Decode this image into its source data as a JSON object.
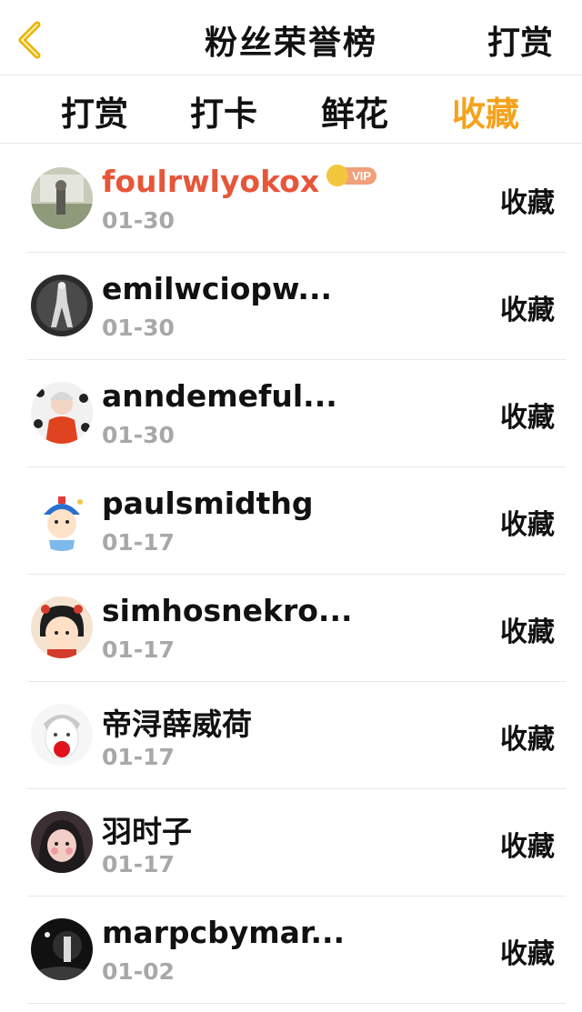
{
  "header": {
    "title": "粉丝荣誉榜",
    "right_action": "打赏",
    "back_icon": "chevron-left-icon",
    "back_icon_color": "#e9b100"
  },
  "tabs": [
    {
      "label": "打赏",
      "active": false
    },
    {
      "label": "打卡",
      "active": false
    },
    {
      "label": "鲜花",
      "active": false
    },
    {
      "label": "收藏",
      "active": true
    }
  ],
  "colors": {
    "accent": "#f5a21b",
    "vip_name": "#e8563a",
    "date": "#a8a8a8"
  },
  "rows": [
    {
      "name": "foulrwlyokox",
      "date": "01-30",
      "action": "收藏",
      "vip": true,
      "vip_label": "VIP",
      "avatar": "avatar-outdoor-person"
    },
    {
      "name": "emilwciopw...",
      "date": "01-30",
      "action": "收藏",
      "vip": false,
      "avatar": "avatar-bw-figure"
    },
    {
      "name": "anndemeful...",
      "date": "01-30",
      "action": "收藏",
      "vip": false,
      "avatar": "avatar-red-shirt"
    },
    {
      "name": "paulsmidthg",
      "date": "01-17",
      "action": "收藏",
      "vip": false,
      "avatar": "avatar-cartoon-boy"
    },
    {
      "name": "simhosnekro...",
      "date": "01-17",
      "action": "收藏",
      "vip": false,
      "avatar": "avatar-cartoon-girl"
    },
    {
      "name": "帝浔薛威荷",
      "date": "01-17",
      "action": "收藏",
      "vip": false,
      "avatar": "avatar-white-face"
    },
    {
      "name": "羽时子",
      "date": "01-17",
      "action": "收藏",
      "vip": false,
      "avatar": "avatar-dark-girl"
    },
    {
      "name": "marpcbymar...",
      "date": "01-02",
      "action": "收藏",
      "vip": false,
      "avatar": "avatar-dark-photo"
    }
  ]
}
